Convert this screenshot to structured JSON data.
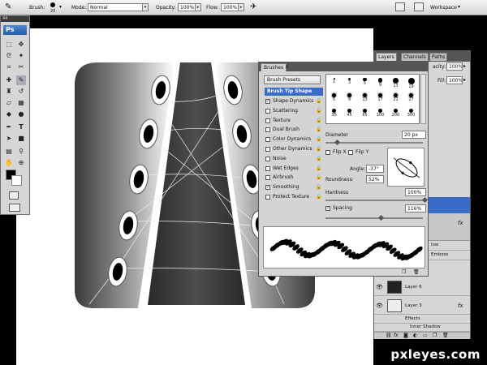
{
  "options_bar": {
    "brush_label": "Brush:",
    "brush_size": "20",
    "mode_label": "Mode:",
    "mode_value": "Normal",
    "opacity_label": "Opacity:",
    "opacity_value": "100%",
    "flow_label": "Flow:",
    "flow_value": "100%",
    "workspace_label": "Workspace"
  },
  "toolbox": {
    "collapse_label": "44",
    "logo": "Ps",
    "tools": [
      "marquee-tool",
      "move-tool",
      "lasso-tool",
      "magic-wand-tool",
      "crop-tool",
      "slice-tool",
      "healing-brush-tool",
      "brush-tool",
      "clone-stamp-tool",
      "history-brush-tool",
      "eraser-tool",
      "gradient-tool",
      "blur-tool",
      "dodge-tool",
      "pen-tool",
      "type-tool",
      "path-selection-tool",
      "shape-tool",
      "notes-tool",
      "eyedropper-tool",
      "hand-tool",
      "zoom-tool"
    ]
  },
  "brushes_panel": {
    "tab": "Brushes",
    "presets_button": "Brush Presets",
    "tip_shape": "Brush Tip Shape",
    "options": [
      {
        "label": "Shape Dynamics",
        "checked": true
      },
      {
        "label": "Scattering",
        "checked": false
      },
      {
        "label": "Texture",
        "checked": false
      },
      {
        "label": "Dual Brush",
        "checked": false
      },
      {
        "label": "Color Dynamics",
        "checked": false
      },
      {
        "label": "Other Dynamics",
        "checked": false
      },
      {
        "label": "Noise",
        "checked": false
      },
      {
        "label": "Wet Edges",
        "checked": false
      },
      {
        "label": "Airbrush",
        "checked": false
      },
      {
        "label": "Smoothing",
        "checked": true
      },
      {
        "label": "Protect Texture",
        "checked": false
      }
    ],
    "tip_sizes": [
      "1",
      "3",
      "5",
      "9",
      "13",
      "19",
      "5",
      "9",
      "13",
      "17",
      "21",
      "27",
      "35",
      "45",
      "65",
      "100",
      "200",
      "300"
    ],
    "diameter_label": "Diameter",
    "diameter_value": "20 px",
    "flip_x": "Flip X",
    "flip_y": "Flip Y",
    "angle_label": "Angle:",
    "angle_value": "-37°",
    "roundness_label": "Roundness:",
    "roundness_value": "52%",
    "hardness_label": "Hardness",
    "hardness_value": "100%",
    "spacing_label": "Spacing",
    "spacing_value": "116%"
  },
  "layers_panel": {
    "tabs": [
      "Layers",
      "Channels",
      "Paths"
    ],
    "opacity_label": "acity:",
    "opacity_value": "100%",
    "fill_label": "Fill:",
    "fill_value": "100%",
    "rows": [
      {
        "name": "low",
        "extra": ""
      },
      {
        "name": "Emboss",
        "extra": ""
      },
      {
        "name": "Layer 6",
        "extra": ""
      },
      {
        "name": "Layer 3",
        "extra": "fx"
      },
      {
        "name": "Effects",
        "extra": ""
      },
      {
        "name": "Inner Shadow",
        "extra": ""
      }
    ]
  },
  "watermark": "pxleyes.com"
}
